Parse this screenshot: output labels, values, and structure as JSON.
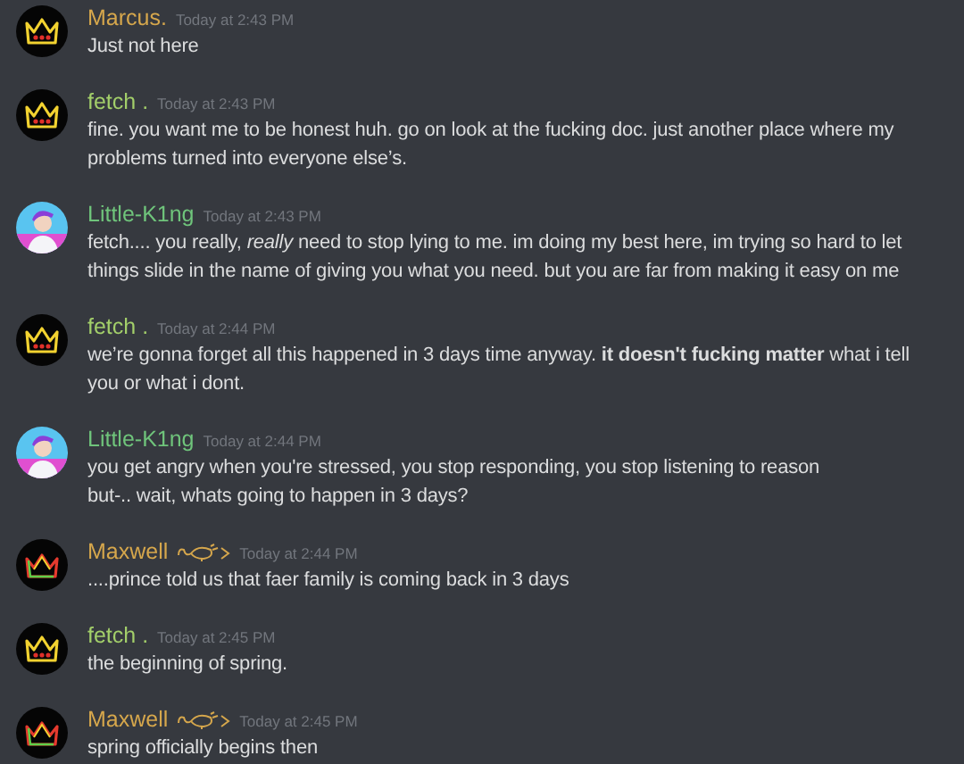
{
  "messages": [
    {
      "author": "Marcus.",
      "color": "#d6a74c",
      "kind": "crown",
      "badge": false,
      "time": "Today at 2:43 PM",
      "lines": [
        "Just not here"
      ]
    },
    {
      "author": "fetch .",
      "color": "#a3cf6a",
      "kind": "crown",
      "badge": false,
      "time": "Today at 2:43 PM",
      "lines": [
        "fine. you want me to be honest huh. go on look at the fucking doc. just another place where my problems turned into everyone else’s."
      ]
    },
    {
      "author": "Little-K1ng",
      "color": "#6fc47b",
      "kind": "figure",
      "badge": false,
      "time": "Today at 2:43 PM",
      "lines": [
        "fetch.... you really, *really* need to stop lying to me. im doing my best here, im trying so hard to let things slide in the name of giving you what you need. but you are far from making it easy on me"
      ]
    },
    {
      "author": "fetch .",
      "color": "#a3cf6a",
      "kind": "crown",
      "badge": false,
      "time": "Today at 2:44 PM",
      "lines": [
        "we’re gonna forget all this happened in 3 days time anyway. **it doesn't fucking matter** what i tell you or what i dont."
      ]
    },
    {
      "author": "Little-K1ng",
      "color": "#6fc47b",
      "kind": "figure",
      "badge": false,
      "time": "Today at 2:44 PM",
      "lines": [
        "you get angry when you're stressed, you stop responding, you stop listening to reason",
        "but-.. wait, whats going to happen in 3 days?"
      ]
    },
    {
      "author": "Maxwell",
      "color": "#d6a74c",
      "kind": "tricolor",
      "badge": true,
      "time": "Today at 2:44 PM",
      "lines": [
        "....prince told us that faer family is coming back in 3 days"
      ]
    },
    {
      "author": "fetch .",
      "color": "#a3cf6a",
      "kind": "crown",
      "badge": false,
      "time": "Today at 2:45 PM",
      "lines": [
        "the beginning of spring."
      ]
    },
    {
      "author": "Maxwell",
      "color": "#d6a74c",
      "kind": "tricolor",
      "badge": true,
      "time": "Today at 2:45 PM",
      "lines": [
        "spring officially begins then"
      ]
    }
  ]
}
